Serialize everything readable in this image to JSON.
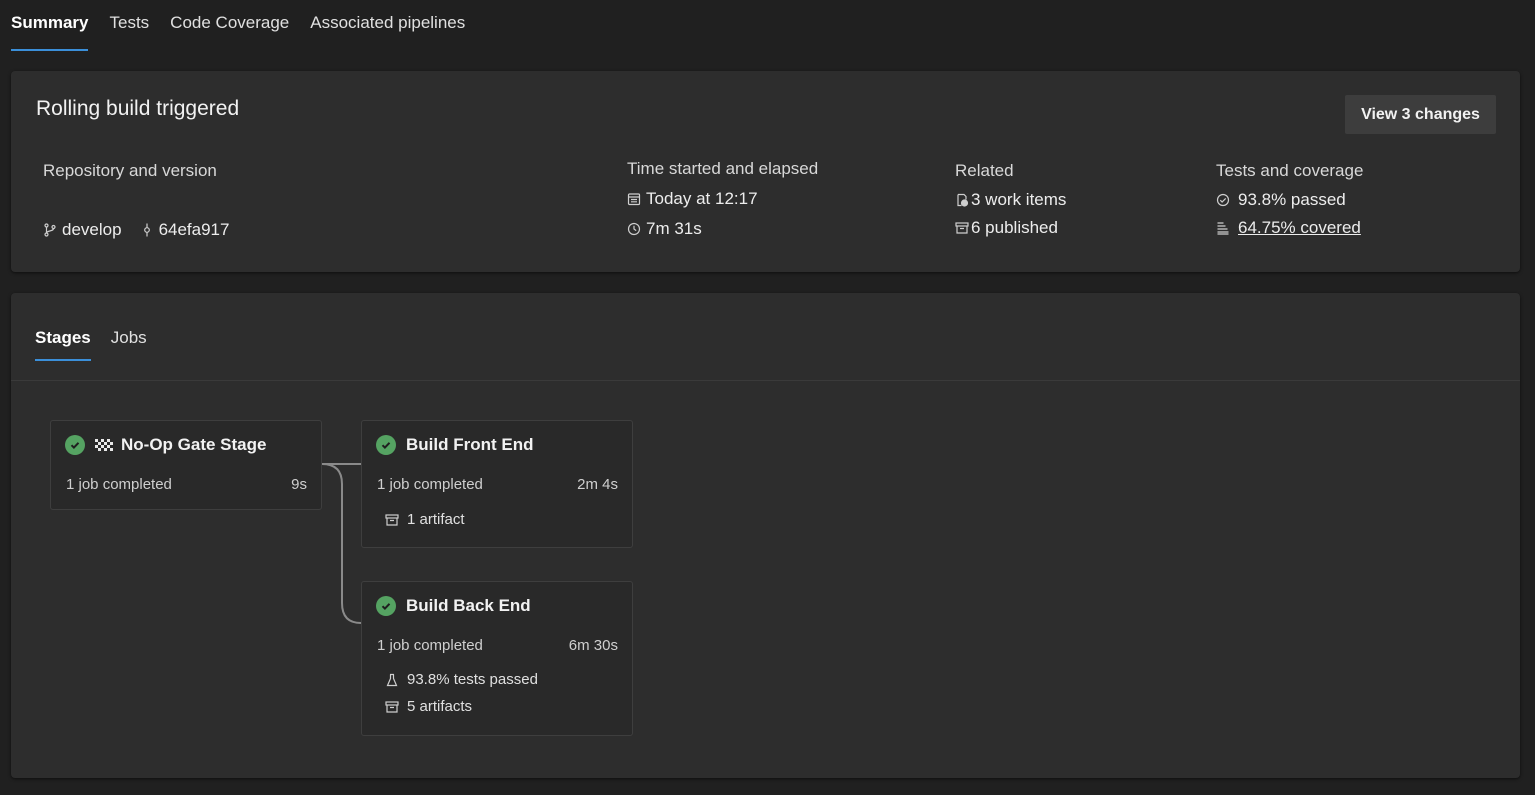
{
  "top_tabs": [
    {
      "label": "Summary",
      "active": true
    },
    {
      "label": "Tests",
      "active": false
    },
    {
      "label": "Code Coverage",
      "active": false
    },
    {
      "label": "Associated pipelines",
      "active": false
    }
  ],
  "summary": {
    "title": "Rolling build triggered",
    "view_changes_label": "View 3 changes",
    "repo": {
      "label": "Repository and version",
      "branch": "develop",
      "commit": "64efa917"
    },
    "time": {
      "label": "Time started and elapsed",
      "started": "Today at 12:17",
      "elapsed": "7m 31s"
    },
    "related": {
      "label": "Related",
      "work_items": "3 work items",
      "published": "6 published"
    },
    "tests": {
      "label": "Tests and coverage",
      "passed": "93.8% passed",
      "covered": "64.75% covered"
    }
  },
  "stages_tabs": [
    {
      "label": "Stages",
      "active": true
    },
    {
      "label": "Jobs",
      "active": false
    }
  ],
  "stages": [
    {
      "name": "No-Op Gate Stage",
      "status": "succeeded",
      "jobs": "1 job completed",
      "duration": "9s",
      "extras": []
    },
    {
      "name": "Build Front End",
      "status": "succeeded",
      "jobs": "1 job completed",
      "duration": "2m 4s",
      "extras": [
        "1 artifact"
      ]
    },
    {
      "name": "Build Back End",
      "status": "succeeded",
      "jobs": "1 job completed",
      "duration": "6m 30s",
      "extras": [
        "93.8% tests passed",
        "5 artifacts"
      ]
    }
  ],
  "colors": {
    "success": "#55a362",
    "accent": "#3b8fd9",
    "background": "#202020",
    "card": "#2d2d2d"
  }
}
